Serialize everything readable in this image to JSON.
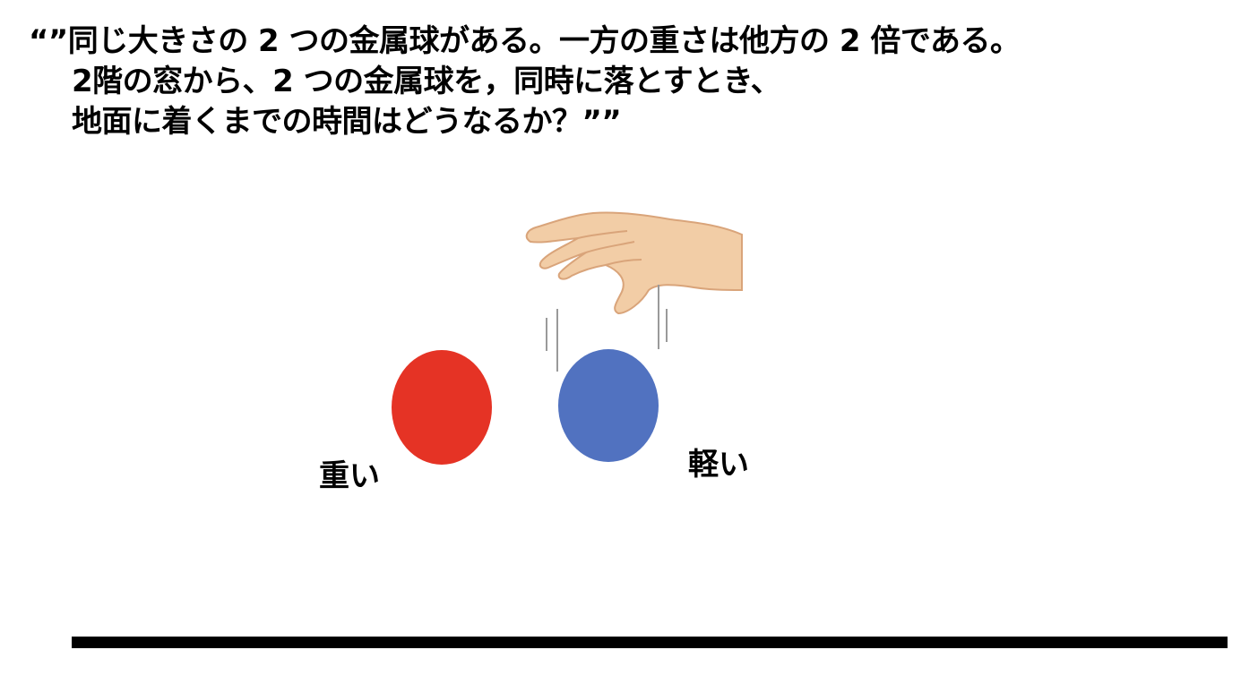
{
  "question": {
    "lines": [
      "“”同じ大きさの 2 つの金属球がある。一方の重さは他方の 2 倍である。",
      "2階の窓から、2 つの金属球を，同時に落とすとき、",
      "地面に着くまでの時間はどうなるか？””"
    ]
  },
  "balls": {
    "heavy": {
      "label": "重い",
      "color": "#e53325"
    },
    "light": {
      "label": "軽い",
      "color": "#5172c0"
    }
  },
  "hand": {
    "skin_color": "#f2cda6",
    "shadow_color": "#d9a47a"
  },
  "motion_lines_color": "#9a9a9a",
  "ground_color": "#000000"
}
